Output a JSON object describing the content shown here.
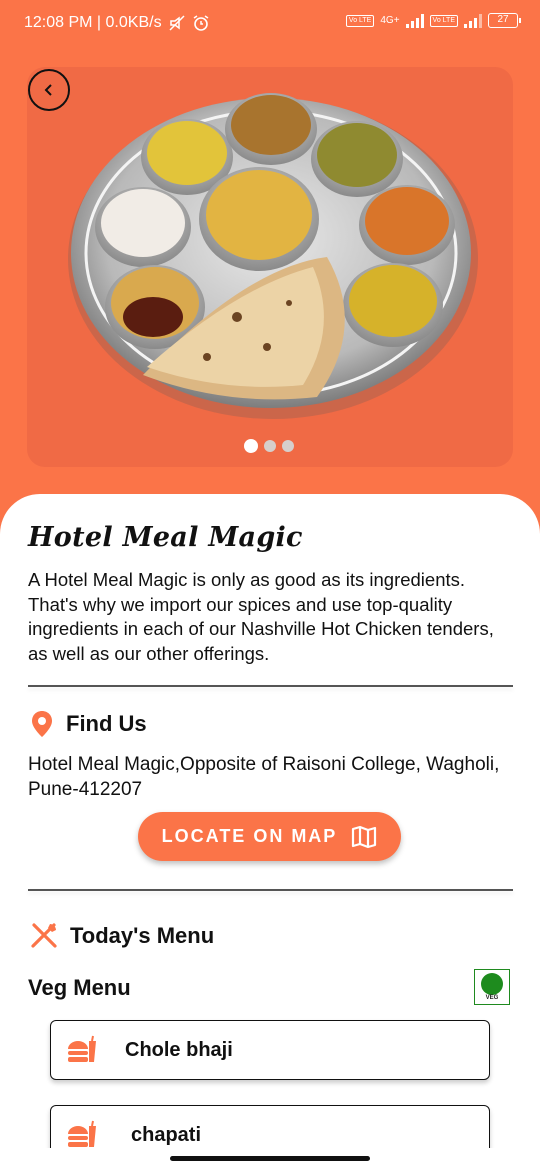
{
  "status_bar": {
    "time_speed": "12:08 PM | 0.0KB/s",
    "network": "4G+",
    "lte": "Vo LTE",
    "battery": "27"
  },
  "hero": {
    "carousel_pages": 3,
    "active_page": 1
  },
  "restaurant": {
    "name": "Hotel Meal Magic",
    "description": "A Hotel Meal Magic is only as good as its ingredients. That's why we import our spices and use top-quality ingredients in each of our Nashville Hot Chicken tenders, as well as our other offerings."
  },
  "find_us": {
    "title": "Find Us",
    "address": "Hotel Meal Magic,Opposite of Raisoni College, Wagholi, Pune-412207",
    "locate_button": "LOCATE ON MAP"
  },
  "todays_menu": {
    "title": "Today's Menu",
    "veg_title": "Veg Menu",
    "veg_badge": "VEG",
    "items": [
      {
        "name": "Chole bhaji"
      },
      {
        "name": "chapati"
      }
    ]
  },
  "colors": {
    "accent": "#fb7448",
    "veg_green": "#1e8b1e"
  },
  "icons": [
    "back-arrow-icon",
    "location-pin-icon",
    "map-icon",
    "cutlery-icon",
    "food-icon"
  ]
}
